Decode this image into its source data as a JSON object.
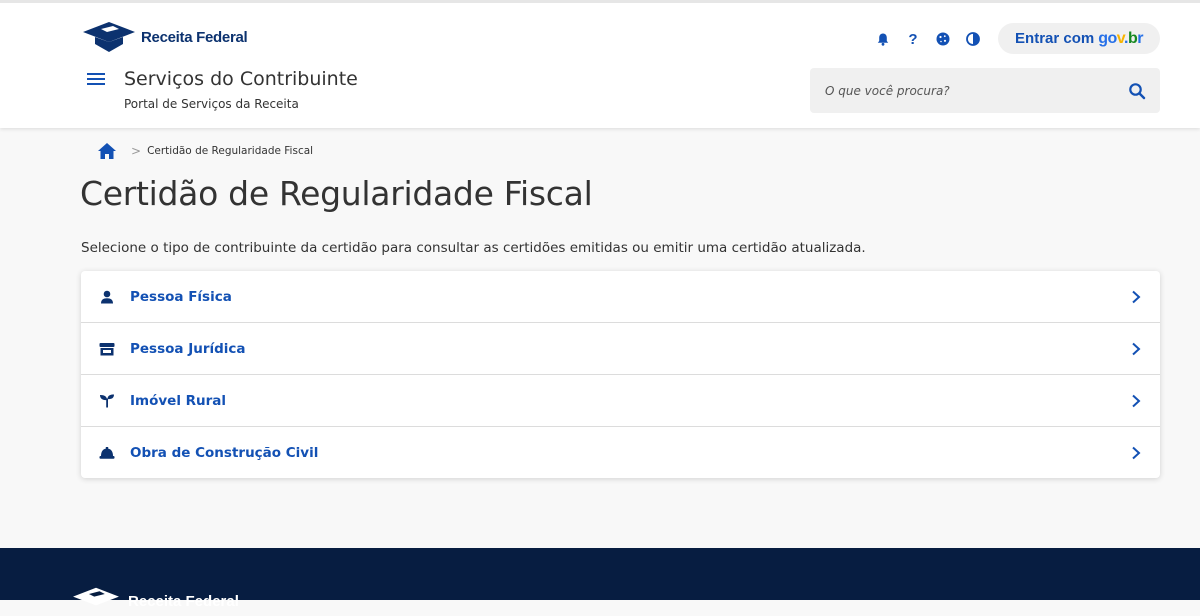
{
  "header": {
    "logo_text": "Receita Federal",
    "login_label": "Entrar com",
    "login_brand": [
      "go",
      "v",
      ".",
      "b",
      "r"
    ],
    "site_title": "Serviços do Contribuinte",
    "site_subtitle": "Portal de Serviços da Receita",
    "help_symbol": "?",
    "search_placeholder": "O que você procura?"
  },
  "breadcrumb": {
    "separator": ">",
    "current": "Certidão de Regularidade Fiscal"
  },
  "main": {
    "title": "Certidão de Regularidade Fiscal",
    "intro": "Selecione o tipo de contribuinte da certidão para consultar as certidões emitidas ou emitir uma certidão atualizada.",
    "options": [
      {
        "label": "Pessoa Física",
        "icon": "user-icon"
      },
      {
        "label": "Pessoa Jurídica",
        "icon": "store-icon"
      },
      {
        "label": "Imóvel Rural",
        "icon": "seedling-icon"
      },
      {
        "label": "Obra de Construção Civil",
        "icon": "hard-hat-icon"
      }
    ]
  },
  "footer": {
    "logo_text": "Receita Federal"
  },
  "colors": {
    "primary": "#1351b4",
    "brand_dark": "#0c326f",
    "footer_bg": "#071d41",
    "page_bg": "#f8f8f8"
  }
}
